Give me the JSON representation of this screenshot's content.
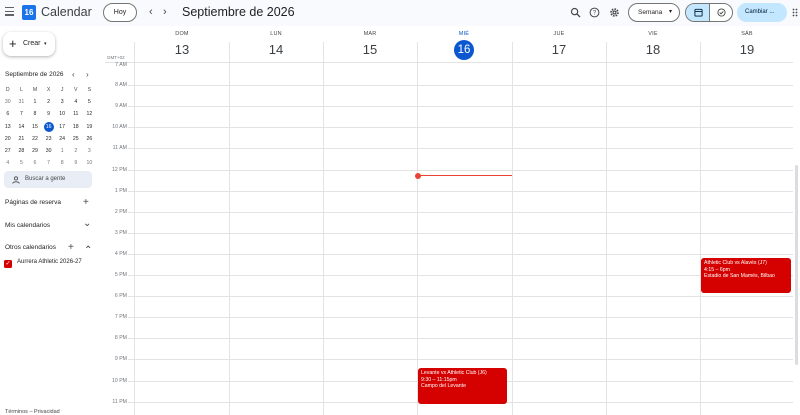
{
  "app": {
    "name": "Calendar",
    "logo_day": "16"
  },
  "toolbar": {
    "today_label": "Hoy",
    "prev": "‹",
    "next": "›",
    "title": "Septiembre de 2026",
    "view_label": "Semana",
    "view_caret": "▾",
    "switch_label": "Cambiar ..."
  },
  "sidebar": {
    "create_label": "Crear",
    "create_plus": "+",
    "create_caret": "▾",
    "mini_title": "Septiembre de 2026",
    "mini_prev": "‹",
    "mini_next": "›",
    "mini_days": [
      "D",
      "L",
      "M",
      "X",
      "J",
      "V",
      "S"
    ],
    "mini_weeks": [
      [
        "30",
        "31",
        "1",
        "2",
        "3",
        "4",
        "5"
      ],
      [
        "6",
        "7",
        "8",
        "9",
        "10",
        "11",
        "12"
      ],
      [
        "13",
        "14",
        "15",
        "16",
        "17",
        "18",
        "19"
      ],
      [
        "20",
        "21",
        "22",
        "23",
        "24",
        "25",
        "26"
      ],
      [
        "27",
        "28",
        "29",
        "30",
        "1",
        "2",
        "3"
      ],
      [
        "4",
        "5",
        "6",
        "7",
        "8",
        "9",
        "10"
      ]
    ],
    "search_people": "Buscar a gente",
    "booking_pages": "Páginas de reserva",
    "booking_plus": "+",
    "my_calendars": "Mis calendarios",
    "other_calendars": "Otros calendarios",
    "other_plus": "+",
    "chevron_down": "⌄",
    "chevron_up": "⌃",
    "calendar_item": "Aurrera Athletic 2026-27",
    "calendar_item_color": "#d50000",
    "check": "✓",
    "footer": "Términos – Privacidad"
  },
  "week": {
    "gmt": "GMT+02",
    "days": [
      {
        "name": "DOM",
        "num": "13"
      },
      {
        "name": "LUN",
        "num": "14"
      },
      {
        "name": "MAR",
        "num": "15"
      },
      {
        "name": "MIÉ",
        "num": "16",
        "today": true
      },
      {
        "name": "JUE",
        "num": "17"
      },
      {
        "name": "VIE",
        "num": "18"
      },
      {
        "name": "SÁB",
        "num": "19"
      }
    ],
    "hours": [
      "7 AM",
      "8 AM",
      "9 AM",
      "10 AM",
      "11 AM",
      "12 PM",
      "1 PM",
      "2 PM",
      "3 PM",
      "4 PM",
      "5 PM",
      "6 PM",
      "7 PM",
      "8 PM",
      "9 PM",
      "10 PM",
      "11 PM"
    ]
  },
  "events": [
    {
      "title": "Athletic Club vs Alavés (J7)",
      "time": "4:15 – 6pm",
      "location": "Estadio de San Mamés, Bilbao",
      "color": "#d50000"
    },
    {
      "title": "Levante vs Athletic Club (J6)",
      "time": "9:30 – 11:15pm",
      "location": "Campo del Levante",
      "color": "#d50000"
    }
  ],
  "colors": {
    "accent": "#0b57d0",
    "now_line": "#ea4335",
    "selected_view": "#c2e7ff"
  }
}
